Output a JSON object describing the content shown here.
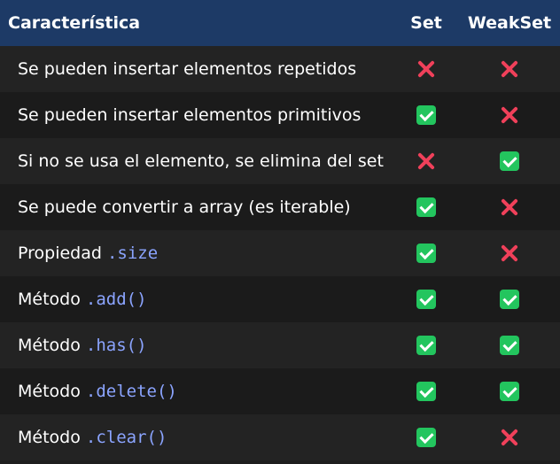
{
  "header": {
    "col_feature": "Característica",
    "col_set": "Set",
    "col_weakset": "WeakSet"
  },
  "rows": [
    {
      "label": "Se pueden insertar elementos repetidos",
      "code": "",
      "set": "cross-icon",
      "weakset": "cross-icon"
    },
    {
      "label": "Se pueden insertar elementos primitivos",
      "code": "",
      "set": "check-icon",
      "weakset": "cross-icon"
    },
    {
      "label": "Si no se usa el elemento, se elimina del set",
      "code": "",
      "set": "cross-icon",
      "weakset": "check-icon"
    },
    {
      "label": "Se puede convertir a array (es iterable)",
      "code": "",
      "set": "check-icon",
      "weakset": "cross-icon"
    },
    {
      "label": "Propiedad ",
      "code": ".size",
      "set": "check-icon",
      "weakset": "cross-icon"
    },
    {
      "label": "Método ",
      "code": ".add()",
      "set": "check-icon",
      "weakset": "check-icon"
    },
    {
      "label": "Método ",
      "code": ".has()",
      "set": "check-icon",
      "weakset": "check-icon"
    },
    {
      "label": "Método ",
      "code": ".delete()",
      "set": "check-icon",
      "weakset": "check-icon"
    },
    {
      "label": "Método ",
      "code": ".clear()",
      "set": "check-icon",
      "weakset": "cross-icon"
    }
  ],
  "colors": {
    "header_bg": "#1d3a66",
    "check": "#23c55e",
    "cross": "#f0405a",
    "code": "#8ba4ff"
  }
}
